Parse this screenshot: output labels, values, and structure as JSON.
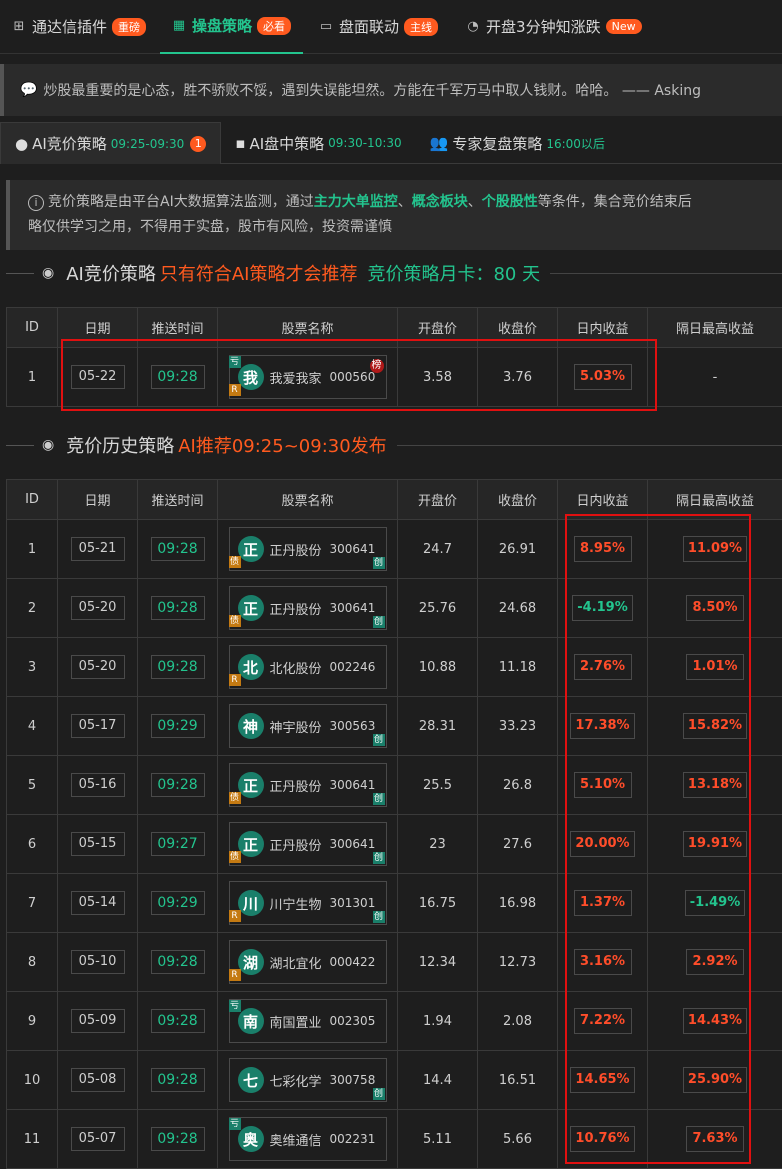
{
  "top_tabs": [
    {
      "icon": "apps-icon",
      "label": "通达信插件",
      "badge": "重磅"
    },
    {
      "icon": "table-icon",
      "label": "操盘策略",
      "badge": "必看"
    },
    {
      "icon": "window-icon",
      "label": "盘面联动",
      "badge": "主线"
    },
    {
      "icon": "gauge-icon",
      "label": "开盘3分钟知涨跌",
      "badge": "New"
    }
  ],
  "quote": "炒股最重要的是心态，胜不骄败不馁，遇到失误能坦然。方能在千军万马中取人钱财。哈哈。 —— Asking",
  "sub_tabs": [
    {
      "icon": "github-icon",
      "label": "AI竞价策略",
      "time": "09:25-09:30",
      "count": "1"
    },
    {
      "icon": "monitor-icon",
      "label": "AI盘中策略",
      "time": "09:30-10:30"
    },
    {
      "icon": "users-icon",
      "label": "专家复盘策略",
      "time": "16:00以后"
    }
  ],
  "info": {
    "p1": "竞价策略是由平台AI大数据算法监测，通过",
    "h1": "主力大单监控",
    "s1": "、",
    "h2": "概念板块",
    "s2": "、",
    "h3": "个股股性",
    "p2": "等条件，集合竞价结束后",
    "line2": "略仅供学习之用，不得用于实盘，股市有风险，投资需谨慎"
  },
  "section1": {
    "title": "AI竞价策略",
    "orange": "只有符合AI策略才会推荐",
    "green": "竞价策略月卡：80 天"
  },
  "section2": {
    "title": "竞价历史策略",
    "orange": "AI推荐09:25~09:30发布"
  },
  "columns": [
    "ID",
    "日期",
    "推送时间",
    "股票名称",
    "开盘价",
    "收盘价",
    "日内收益",
    "隔日最高收益"
  ],
  "today": [
    {
      "id": "1",
      "date": "05-22",
      "time": "09:28",
      "avatar": "我",
      "name": "我爱我家",
      "code": "000560",
      "tl": "亏",
      "bl": "R",
      "br": "榜",
      "open": "3.58",
      "close": "3.76",
      "intraday": "5.03%",
      "intraday_dir": "up",
      "next": "-"
    }
  ],
  "history": [
    {
      "id": "1",
      "date": "05-21",
      "time": "09:28",
      "avatar": "正",
      "name": "正丹股份",
      "code": "300641",
      "bl": "债",
      "br": "创",
      "open": "24.7",
      "close": "26.91",
      "intraday": "8.95%",
      "intraday_dir": "up",
      "next": "11.09%",
      "next_dir": "up"
    },
    {
      "id": "2",
      "date": "05-20",
      "time": "09:28",
      "avatar": "正",
      "name": "正丹股份",
      "code": "300641",
      "bl": "债",
      "br": "创",
      "open": "25.76",
      "close": "24.68",
      "intraday": "-4.19%",
      "intraday_dir": "down",
      "next": "8.50%",
      "next_dir": "up"
    },
    {
      "id": "3",
      "date": "05-20",
      "time": "09:28",
      "avatar": "北",
      "name": "北化股份",
      "code": "002246",
      "bl": "R",
      "open": "10.88",
      "close": "11.18",
      "intraday": "2.76%",
      "intraday_dir": "up",
      "next": "1.01%",
      "next_dir": "up"
    },
    {
      "id": "4",
      "date": "05-17",
      "time": "09:29",
      "avatar": "神",
      "name": "神宇股份",
      "code": "300563",
      "br": "创",
      "open": "28.31",
      "close": "33.23",
      "intraday": "17.38%",
      "intraday_dir": "up",
      "next": "15.82%",
      "next_dir": "up"
    },
    {
      "id": "5",
      "date": "05-16",
      "time": "09:28",
      "avatar": "正",
      "name": "正丹股份",
      "code": "300641",
      "bl": "债",
      "br": "创",
      "open": "25.5",
      "close": "26.8",
      "intraday": "5.10%",
      "intraday_dir": "up",
      "next": "13.18%",
      "next_dir": "up"
    },
    {
      "id": "6",
      "date": "05-15",
      "time": "09:27",
      "avatar": "正",
      "name": "正丹股份",
      "code": "300641",
      "bl": "债",
      "br": "创",
      "open": "23",
      "close": "27.6",
      "intraday": "20.00%",
      "intraday_dir": "up",
      "next": "19.91%",
      "next_dir": "up"
    },
    {
      "id": "7",
      "date": "05-14",
      "time": "09:29",
      "avatar": "川",
      "name": "川宁生物",
      "code": "301301",
      "bl": "R",
      "br": "创",
      "open": "16.75",
      "close": "16.98",
      "intraday": "1.37%",
      "intraday_dir": "up",
      "next": "-1.49%",
      "next_dir": "down"
    },
    {
      "id": "8",
      "date": "05-10",
      "time": "09:28",
      "avatar": "湖",
      "name": "湖北宜化",
      "code": "000422",
      "bl": "R",
      "open": "12.34",
      "close": "12.73",
      "intraday": "3.16%",
      "intraday_dir": "up",
      "next": "2.92%",
      "next_dir": "up"
    },
    {
      "id": "9",
      "date": "05-09",
      "time": "09:28",
      "avatar": "南",
      "name": "南国置业",
      "code": "002305",
      "tl": "亏",
      "open": "1.94",
      "close": "2.08",
      "intraday": "7.22%",
      "intraday_dir": "up",
      "next": "14.43%",
      "next_dir": "up"
    },
    {
      "id": "10",
      "date": "05-08",
      "time": "09:28",
      "avatar": "七",
      "name": "七彩化学",
      "code": "300758",
      "br": "创",
      "open": "14.4",
      "close": "16.51",
      "intraday": "14.65%",
      "intraday_dir": "up",
      "next": "25.90%",
      "next_dir": "up"
    },
    {
      "id": "11",
      "date": "05-07",
      "time": "09:28",
      "avatar": "奥",
      "name": "奥维通信",
      "code": "002231",
      "tl": "亏",
      "open": "5.11",
      "close": "5.66",
      "intraday": "10.76%",
      "intraday_dir": "up",
      "next": "7.63%",
      "next_dir": "up"
    }
  ]
}
